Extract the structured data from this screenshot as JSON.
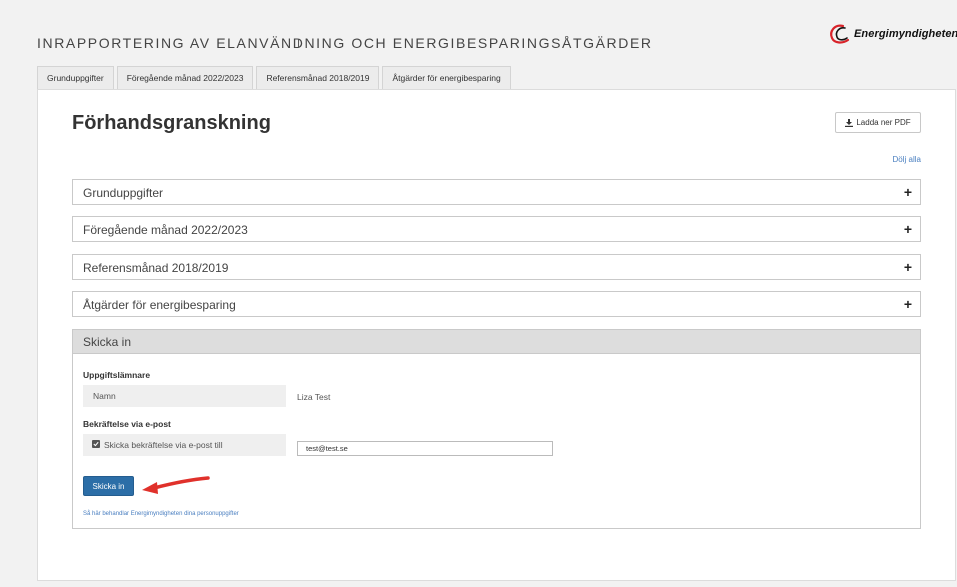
{
  "app": {
    "title": "INRAPPORTERING AV ELANVÄNDNING OCH ENERGIBESPARINGSÅTGÄRDER",
    "logo_text": "Energimyndigheten"
  },
  "tabs": [
    {
      "label": "Grunduppgifter"
    },
    {
      "label": "Föregående månad 2022/2023"
    },
    {
      "label": "Referensmånad 2018/2019"
    },
    {
      "label": "Åtgärder för energibesparing"
    }
  ],
  "main": {
    "title": "Förhandsgranskning",
    "pdf_button": "Ladda ner PDF",
    "hide_all": "Dölj alla",
    "sections": [
      {
        "label": "Grunduppgifter"
      },
      {
        "label": "Föregående månad 2022/2023"
      },
      {
        "label": "Referensmånad 2018/2019"
      },
      {
        "label": "Åtgärder för energibesparing"
      }
    ],
    "submit": {
      "heading": "Skicka in",
      "submitter_label": "Uppgiftslämnare",
      "name_label": "Namn",
      "name_value": "Liza Test",
      "confirm_label": "Bekräftelse via e-post",
      "checkbox_label": "Skicka bekräftelse via e-post till",
      "email_value": "test@test.se",
      "button": "Skicka in",
      "privacy_link": "Så här behandlar Energimyndigheten dina personuppgifter"
    }
  },
  "colors": {
    "accent": "#2c6ea7",
    "link": "#4a7fc0",
    "arrow": "#e0312b",
    "logo_red": "#d8232a"
  },
  "icons": {
    "download": "download-icon",
    "expand": "plus-icon",
    "checkbox": "checkbox-checked-icon",
    "annotation": "red-arrow-icon",
    "cursor": "text-cursor-icon"
  }
}
